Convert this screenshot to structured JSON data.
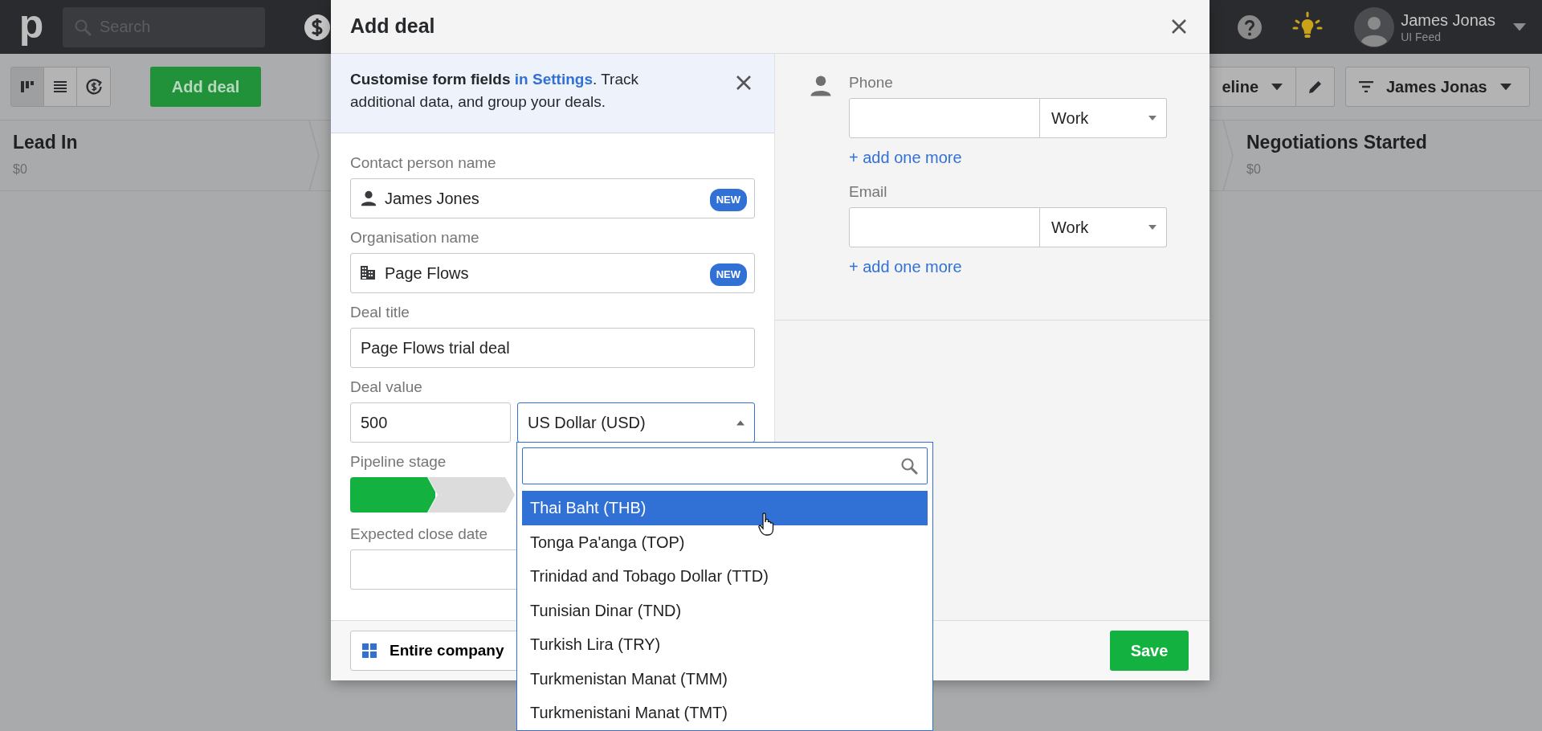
{
  "app_header": {
    "logo": "p",
    "search": {
      "placeholder": "Search"
    },
    "user": {
      "name": "James Jonas",
      "company": "UI Feed"
    }
  },
  "toolbar": {
    "view_buttons": [
      {
        "kind": "pipeline",
        "selected": true
      },
      {
        "kind": "list",
        "selected": false
      },
      {
        "kind": "forecast",
        "selected": false
      }
    ],
    "add_button": "Add deal",
    "pipeline_button": "eline",
    "filter_button": "James Jonas"
  },
  "stages": [
    {
      "title": "Lead In",
      "amount": "$0"
    },
    {
      "title": "Negotiations Started",
      "amount": "$0"
    }
  ],
  "modal": {
    "title": "Add deal",
    "banner": {
      "bold": "Customise form fields",
      "link": "in Settings",
      "rest": ". Track additional data, and group your deals."
    },
    "fields": [
      {
        "kind": "person",
        "label": "Contact person name",
        "value": "James Jones",
        "badge": "NEW"
      },
      {
        "kind": "organization",
        "label": "Organisation name",
        "value": "Page Flows",
        "badge": "NEW"
      },
      {
        "kind": "text",
        "label": "Deal title",
        "value": "Page Flows trial deal"
      },
      {
        "kind": "money",
        "label": "Deal value",
        "value": "500",
        "currency": "US Dollar (USD)",
        "expanded": true
      },
      {
        "kind": "stages",
        "label": "Pipeline stage",
        "stages": [
          {
            "done": true
          },
          {
            "done": false
          }
        ]
      },
      {
        "kind": "date",
        "label": "Expected close date"
      }
    ],
    "contact_fields": [
      {
        "label": "Phone",
        "type": "Work",
        "add_link": "+ add one more"
      },
      {
        "label": "Email",
        "type": "Work",
        "add_link": "+ add one more"
      }
    ],
    "visibility": "Entire company",
    "save_button": "Save"
  },
  "currency_dropdown": {
    "options": [
      {
        "label": "Thai Baht (THB)",
        "selected": true
      },
      {
        "label": "Tonga Pa'anga (TOP)",
        "selected": false
      },
      {
        "label": "Trinidad and Tobago Dollar (TTD)",
        "selected": false
      },
      {
        "label": "Tunisian Dinar (TND)",
        "selected": false
      },
      {
        "label": "Turkish Lira (TRY)",
        "selected": false
      },
      {
        "label": "Turkmenistan Manat (TMM)",
        "selected": false
      },
      {
        "label": "Turkmenistani Manat (TMT)",
        "selected": false
      }
    ]
  }
}
